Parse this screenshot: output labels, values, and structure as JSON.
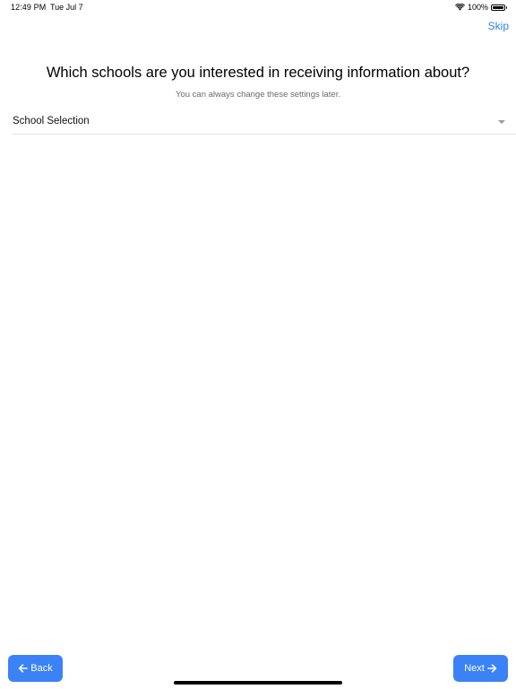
{
  "status_bar": {
    "time": "12:49 PM",
    "date": "Tue Jul 7",
    "battery_percent": "100%",
    "battery_level": 1.0,
    "icons": [
      "wifi-icon",
      "battery-icon"
    ]
  },
  "header": {
    "skip_label": "Skip"
  },
  "main": {
    "title": "Which schools are you interested in receiving information about?",
    "subtitle": "You can always change these settings later.",
    "school_select": {
      "label": "School Selection",
      "icon": "caret-down-icon"
    }
  },
  "footer": {
    "back_label": "Back",
    "next_label": "Next",
    "back_icon": "arrow-left-icon",
    "next_icon": "arrow-right-icon"
  },
  "colors": {
    "accent": "#3b82f6",
    "link": "#2f80ed",
    "subtitle": "#6b6b6b",
    "divider": "#e3e3e3"
  }
}
